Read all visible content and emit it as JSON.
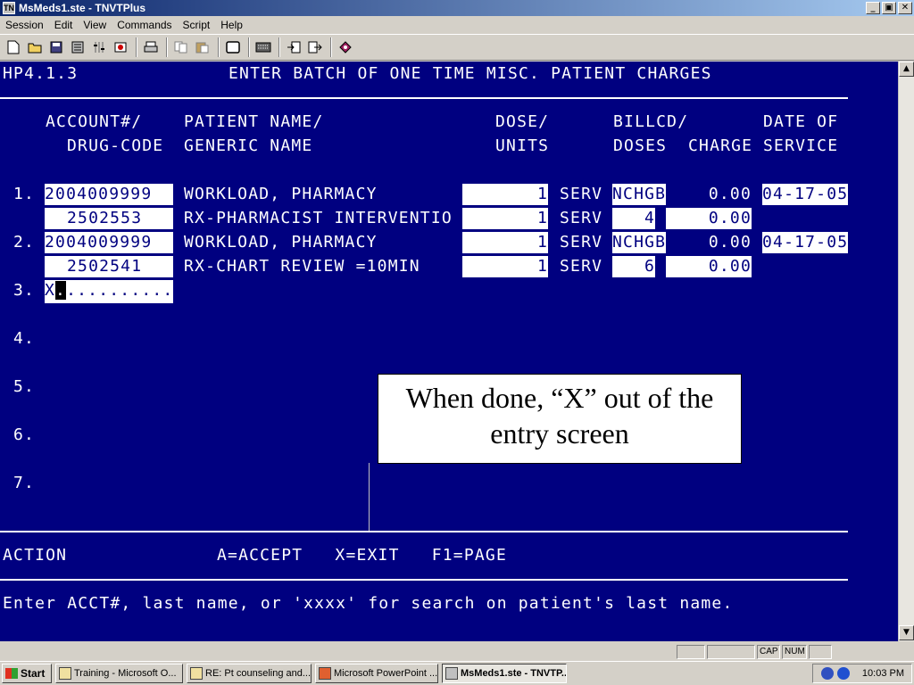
{
  "window": {
    "title": "MsMeds1.ste - TNVTPlus",
    "app_icon": "TN",
    "minimize": "_",
    "maximize": "▣",
    "close": "✕"
  },
  "menu": [
    {
      "label": "Session"
    },
    {
      "label": "Edit"
    },
    {
      "label": "View"
    },
    {
      "label": "Commands"
    },
    {
      "label": "Script"
    },
    {
      "label": "Help"
    }
  ],
  "toolbar_icons": [
    "new-icon",
    "open-icon",
    "save-icon",
    "properties-icon",
    "settings-icon",
    "record-icon",
    "print-icon",
    "copy-icon",
    "paste-icon",
    "blank-icon",
    "keyboard-icon",
    "import-icon",
    "export-icon",
    "macro-icon"
  ],
  "screen": {
    "code": "HP4.1.3",
    "title": "ENTER BATCH OF ONE TIME MISC. PATIENT CHARGES",
    "headers": {
      "account": "ACCOUNT#/",
      "drug_code": "DRUG-CODE",
      "patient_name": "PATIENT NAME/",
      "generic_name": "GENERIC NAME",
      "dose": "DOSE/",
      "units": "UNITS",
      "billcd": "BILLCD/",
      "doses": "DOSES",
      "charge": "CHARGE",
      "date_of": "DATE OF",
      "service": "SERVICE"
    },
    "entries": [
      {
        "num": "1.",
        "account": "2004009999",
        "patient_name": "WORKLOAD, PHARMACY",
        "dose": "1",
        "unit": "SERV",
        "billcd": "NCHGB",
        "charge": "0.00",
        "date": "04-17-05",
        "drug_code": "2502553",
        "generic_name": "RX-PHARMACIST INTERVENTIO",
        "dose2": "1",
        "unit2": "SERV",
        "doses": "4",
        "charge2": "0.00"
      },
      {
        "num": "2.",
        "account": "2004009999",
        "patient_name": "WORKLOAD, PHARMACY",
        "dose": "1",
        "unit": "SERV",
        "billcd": "NCHGB",
        "charge": "0.00",
        "date": "04-17-05",
        "drug_code": "2502541",
        "generic_name": "RX-CHART REVIEW =10MIN",
        "dose2": "1",
        "unit2": "SERV",
        "doses": "6",
        "charge2": "0.00"
      }
    ],
    "input_row": {
      "num": "3.",
      "typed": "X",
      "cursor": ".",
      "rest": ".........."
    },
    "empty_rows": [
      "4.",
      "5.",
      "6.",
      "7."
    ],
    "action_label": "ACTION",
    "action_options": "A=ACCEPT   X=EXIT   F1=PAGE",
    "prompt": "Enter ACCT#, last name, or 'xxxx' for search on patient's last name."
  },
  "callout": {
    "text": "When done, “X” out of the entry screen"
  },
  "statusbar": {
    "panels": [
      "",
      "",
      "CAP",
      "NUM",
      ""
    ]
  },
  "taskbar": {
    "start": "Start",
    "tasks": [
      {
        "label": "Training - Microsoft O...",
        "active": false
      },
      {
        "label": "RE: Pt counseling and...",
        "active": false
      },
      {
        "label": "Microsoft PowerPoint ...",
        "active": false
      },
      {
        "label": "MsMeds1.ste - TNVTP...",
        "active": true
      }
    ],
    "clock": "10:03 PM"
  },
  "colors": {
    "terminal_bg": "#000080",
    "terminal_fg": "#ffffff",
    "highlight_bg": "#ffffff",
    "highlight_fg": "#000080"
  }
}
